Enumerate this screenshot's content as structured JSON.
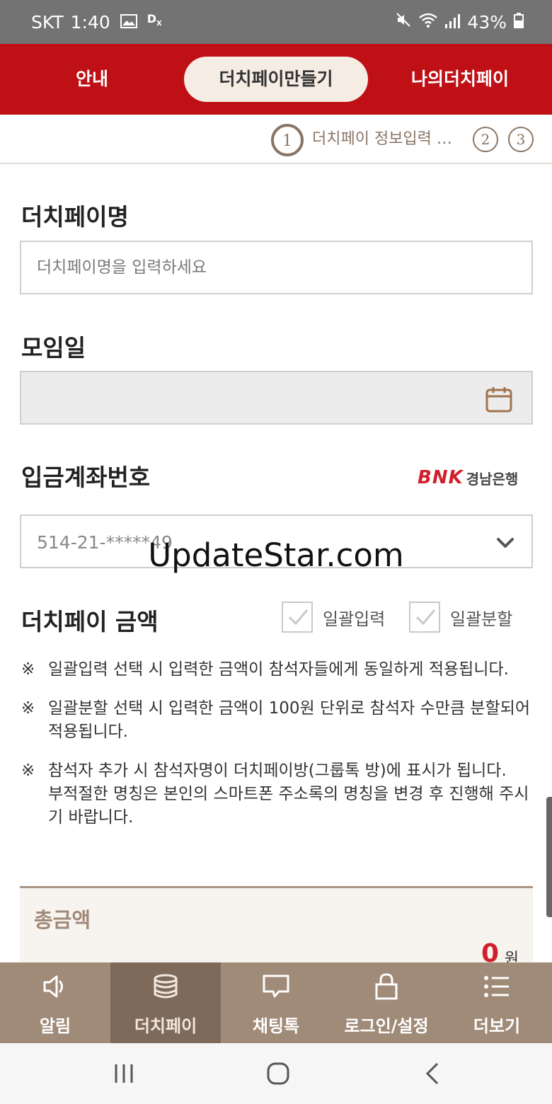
{
  "status_bar": {
    "carrier": "SKT",
    "time": "1:40",
    "battery": "43%"
  },
  "top_tabs": [
    {
      "label": "안내",
      "active": false
    },
    {
      "label": "더치페이만들기",
      "active": true
    },
    {
      "label": "나의더치페이",
      "active": false
    }
  ],
  "steps": {
    "current_number": "1",
    "current_label": "더치페이 정보입력 …",
    "step2": "2",
    "step3": "3"
  },
  "form": {
    "name_title": "더치페이명",
    "name_placeholder": "더치페이명을 입력하세요",
    "date_title": "모임일",
    "account_title": "입금계좌번호",
    "bank_brand": "BNK",
    "bank_name": "경남은행",
    "account_value": "514-21-*****49",
    "amount_title": "더치페이 금액",
    "checkbox_bulk_input": "일괄입력",
    "checkbox_bulk_split": "일괄분할"
  },
  "notes": [
    {
      "mark": "※",
      "paras": [
        "일괄입력 선택 시 입력한 금액이 참석자들에게 동일하게 적용됩니다."
      ]
    },
    {
      "mark": "※",
      "paras": [
        "일괄분할 선택 시 입력한 금액이 100원 단위로 참석자 수만큼 분할되어 적용됩니다."
      ]
    },
    {
      "mark": "※",
      "paras": [
        "참석자 추가 시 참석자명이 더치페이방(그룹톡 방)에 표시가 됩니다.",
        "부적절한 명칭은 본인의 스마트폰 주소록의 명칭을 변경 후 진행해 주시기 바랍니다."
      ]
    }
  ],
  "total": {
    "label": "총금액",
    "value": "0",
    "unit": "원"
  },
  "bottom_nav": [
    {
      "label": "알림",
      "icon": "speaker-icon",
      "active": false
    },
    {
      "label": "더치페이",
      "icon": "coins-icon",
      "active": true
    },
    {
      "label": "채팅톡",
      "icon": "chat-bubble-icon",
      "active": false
    },
    {
      "label": "로그인/설정",
      "icon": "lock-icon",
      "active": false
    },
    {
      "label": "더보기",
      "icon": "menu-list-icon",
      "active": false
    }
  ],
  "watermark": "UpdateStar.com",
  "colors": {
    "brand_red": "#bf1015",
    "nav_brown": "#a08a78",
    "nav_active": "#7e6a5b",
    "step_brown": "#8a7565"
  }
}
